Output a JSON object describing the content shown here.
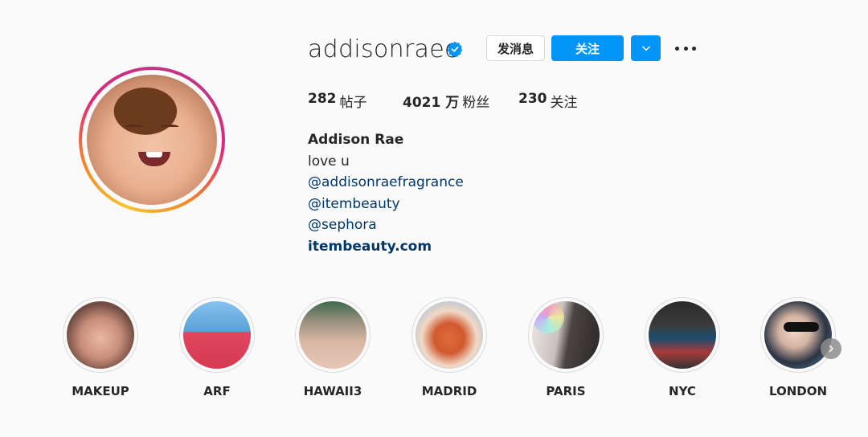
{
  "profile": {
    "username": "addisonraee",
    "verified": true,
    "message_label": "发消息",
    "follow_label": "关注",
    "stats": {
      "posts_count": "282",
      "posts_label": "帖子",
      "followers_count": "4021 万",
      "followers_label": "粉丝",
      "following_count": "230",
      "following_label": "关注"
    },
    "bio": {
      "full_name": "Addison Rae",
      "line1": "love u",
      "mention1": "@addisonraefragrance",
      "mention2": "@itembeauty",
      "mention3": "@sephora",
      "website": "itembeauty.com"
    }
  },
  "highlights": [
    {
      "label": "MAKEUP"
    },
    {
      "label": "ARF"
    },
    {
      "label": "HAWAII3"
    },
    {
      "label": "MADRID"
    },
    {
      "label": "PARIS"
    },
    {
      "label": "NYC"
    },
    {
      "label": "LONDON"
    }
  ],
  "colors": {
    "accent": "#0095f6",
    "link": "#00376b",
    "background": "#fafafa"
  }
}
